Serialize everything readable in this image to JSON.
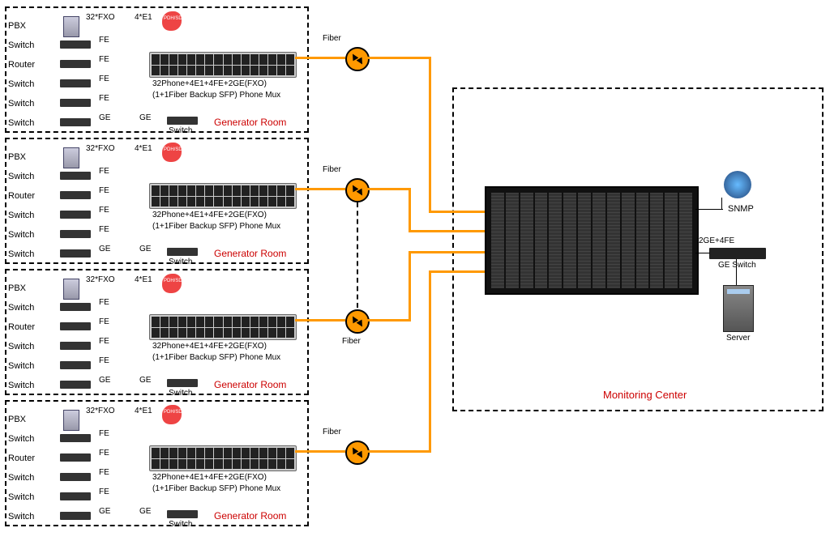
{
  "generator_rooms": [
    {
      "title": "Generator Room"
    },
    {
      "title": "Generator Room"
    },
    {
      "title": "Generator Room"
    },
    {
      "title": "Generator Room"
    }
  ],
  "room_devices": {
    "pbx": "PBX",
    "switch": "Switch",
    "router": "Router"
  },
  "port_labels": {
    "fe": "FE",
    "ge": "GE",
    "fxo": "32*FXO",
    "e1": "4*E1"
  },
  "mux": {
    "line1": "32Phone+4E1+4FE+2GE(FXO)",
    "line2": "(1+1Fiber Backup SFP) Phone Mux"
  },
  "badge": "PDH/SDH/ATM",
  "fiber_label": "Fiber",
  "monitoring": {
    "title": "Monitoring Center",
    "snmp": "SNMP",
    "ge_switch": "GE Switch",
    "server": "Server",
    "link": "2GE+4FE"
  }
}
